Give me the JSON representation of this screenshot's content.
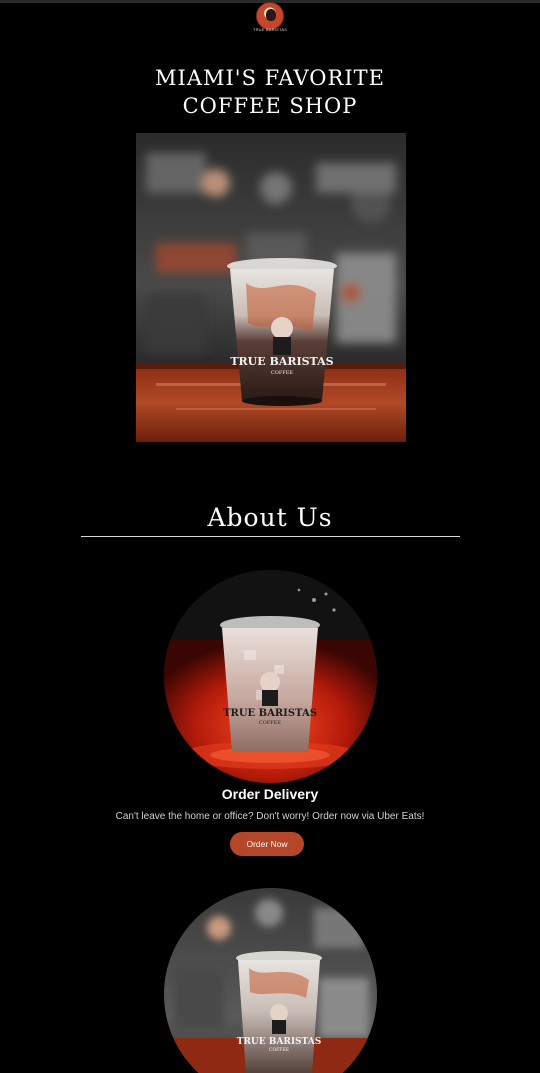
{
  "header": {
    "logo_caption": "TRUE BARISTAS"
  },
  "hero": {
    "title_line1": "MIAMI'S FAVORITE",
    "title_line2": "COFFEE SHOP",
    "cup_brand": "TRUE BARISTAS",
    "cup_sub": "COFFEE"
  },
  "about": {
    "title": "About Us"
  },
  "delivery": {
    "title": "Order Delivery",
    "text": "Can't leave the home or office? Don't worry! Order now via Uber Eats!",
    "button_label": "Order Now"
  },
  "colors": {
    "background": "#000000",
    "accent": "#b5462a"
  }
}
